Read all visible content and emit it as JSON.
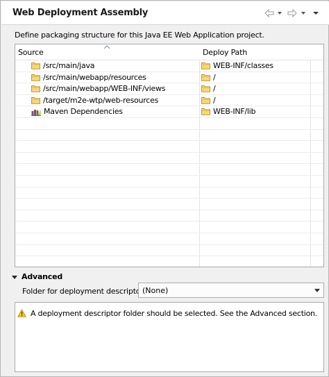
{
  "header": {
    "title": "Web Deployment Assembly"
  },
  "description": "Define packaging structure for this Java EE Web Application project.",
  "table": {
    "columns": {
      "source": "Source",
      "deploy_path": "Deploy Path"
    },
    "rows": [
      {
        "source": "/src/main/java",
        "source_icon": "folder-icon",
        "deploy_path": "WEB-INF/classes"
      },
      {
        "source": "/src/main/webapp/resources",
        "source_icon": "folder-icon",
        "deploy_path": "/"
      },
      {
        "source": "/src/main/webapp/WEB-INF/views",
        "source_icon": "folder-icon",
        "deploy_path": "/"
      },
      {
        "source": "/target/m2e-wtp/web-resources",
        "source_icon": "folder-icon",
        "deploy_path": "/"
      },
      {
        "source": "Maven Dependencies",
        "source_icon": "library-icon",
        "deploy_path": "WEB-INF/lib"
      }
    ]
  },
  "advanced": {
    "label": "Advanced",
    "folder_label": "Folder for deployment descriptor:",
    "folder_value": "(None)"
  },
  "message": {
    "text": "A deployment descriptor folder should be selected. See the Advanced section."
  },
  "colors": {
    "folder": "#e8c55a",
    "warning": "#f2c230"
  }
}
